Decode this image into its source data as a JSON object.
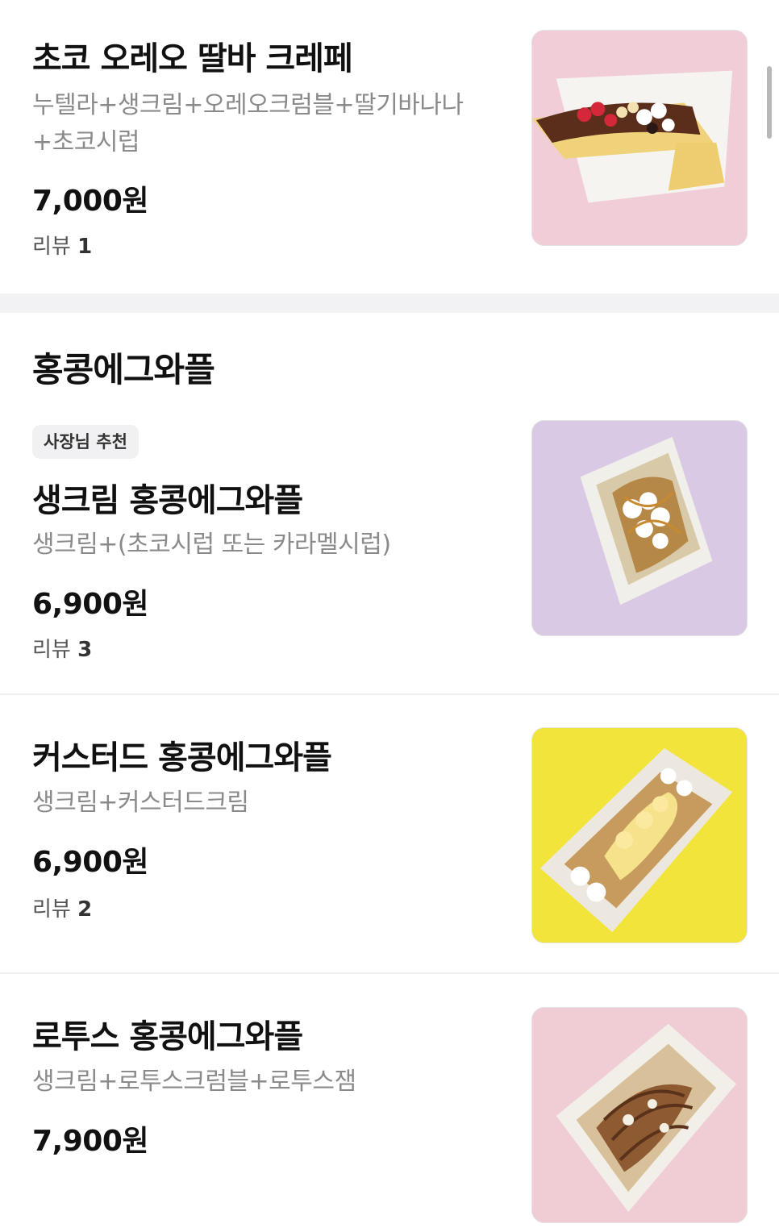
{
  "items": [
    {
      "title": "초코 오레오 딸바 크레페",
      "desc": "누텔라+생크림+오레오크럼블+딸기바나나+초코시럽",
      "price": "7,000원",
      "review_label": "리뷰",
      "review_count": "1",
      "image": "crepe-photo",
      "bg_color": "#f1cdd7"
    },
    {
      "badge": "사장님 추천",
      "title": "생크림 홍콩에그와플",
      "desc": "생크림+(초코시럽 또는 카라멜시럽)",
      "price": "6,900원",
      "review_label": "리뷰",
      "review_count": "3",
      "image": "cream-waffle-photo",
      "bg_color": "#d9c9e4"
    },
    {
      "title": "커스터드 홍콩에그와플",
      "desc": "생크림+커스터드크림",
      "price": "6,900원",
      "review_label": "리뷰",
      "review_count": "2",
      "image": "custard-waffle-photo",
      "bg_color": "#f2e43a"
    },
    {
      "title": "로투스 홍콩에그와플",
      "desc": "생크림+로투스크럼블+로투스잼",
      "price": "7,900원",
      "image": "lotus-waffle-photo",
      "bg_color": "#f0cdd5"
    }
  ],
  "section": {
    "title": "홍콩에그와플"
  }
}
